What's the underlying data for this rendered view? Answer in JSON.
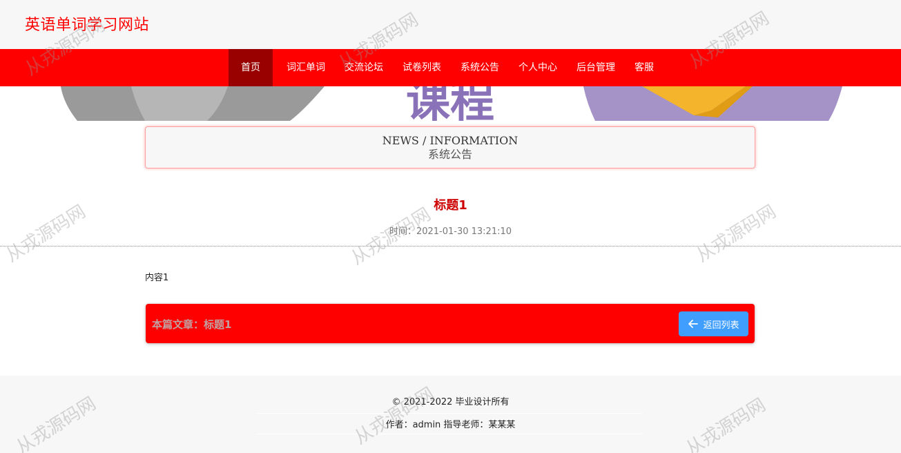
{
  "header": {
    "site_title": "英语单词学习网站"
  },
  "nav": {
    "items": [
      {
        "label": "首页",
        "active": true
      },
      {
        "label": "词汇单词"
      },
      {
        "label": "交流论坛"
      },
      {
        "label": "试卷列表"
      },
      {
        "label": "系统公告"
      },
      {
        "label": "个人中心"
      },
      {
        "label": "后台管理"
      },
      {
        "label": "客服"
      }
    ]
  },
  "banner": {
    "text": "课程"
  },
  "section": {
    "title_en": "NEWS / INFORMATION",
    "title_cn": "系统公告"
  },
  "article": {
    "title": "标题1",
    "time": "时间：2021-01-30 13:21:10",
    "content": "内容1",
    "current_label": "本篇文章：标题1",
    "back_button": "返回列表"
  },
  "footer": {
    "copyright": "© 2021-2022 毕业设计所有",
    "author": "作者：admin 指导老师：某某某"
  },
  "watermark": {
    "text": "从戎源码网"
  },
  "colors": {
    "brand": "#ff0000",
    "nav_active": "#990000",
    "button": "#409eff",
    "title": "#cc0000"
  },
  "icons": {
    "back": "arrow-left-icon"
  }
}
